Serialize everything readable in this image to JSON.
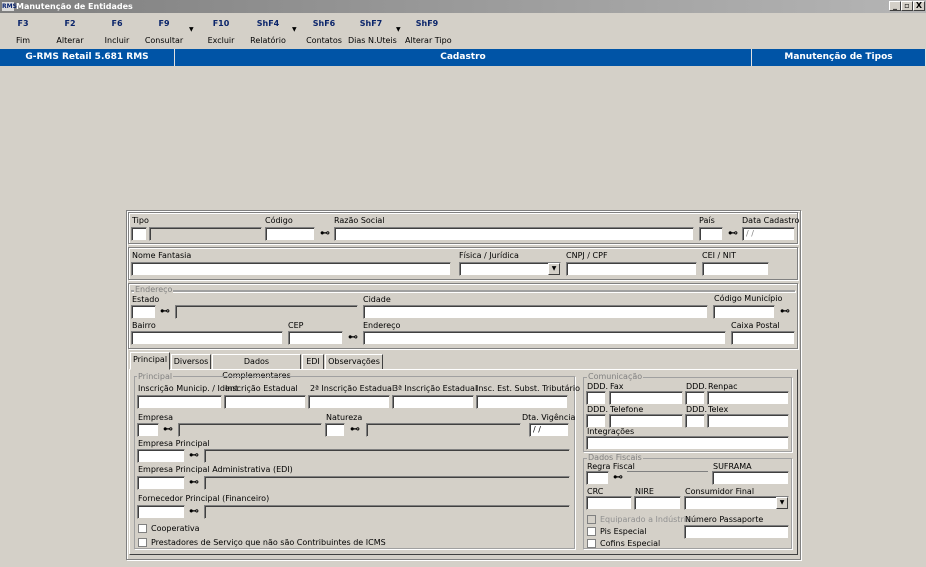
{
  "window": {
    "title": "Manutenção de Entidades",
    "app_icon_text": "RMS",
    "controls": [
      "_",
      "▫",
      "X"
    ]
  },
  "toolbar": [
    {
      "key": "F3",
      "label": "Fim",
      "menu": false
    },
    {
      "key": "F2",
      "label": "Alterar",
      "menu": false
    },
    {
      "key": "F6",
      "label": "Incluir",
      "menu": false
    },
    {
      "key": "F9",
      "label": "Consultar",
      "menu": true
    },
    {
      "key": "F10",
      "label": "Excluir",
      "menu": false
    },
    {
      "key": "ShF4",
      "label": "Relatório",
      "menu": true
    },
    {
      "key": "ShF6",
      "label": "Contatos",
      "menu": false
    },
    {
      "key": "ShF7",
      "label": "Dias N.Uteis",
      "menu": true
    },
    {
      "key": "ShF9",
      "label": "Alterar Tipo",
      "menu": false
    }
  ],
  "header": {
    "app_version": "G-RMS Retail 5.681 RMS",
    "section": "Cadastro",
    "screen": "Manutenção de Tipos"
  },
  "form": {
    "tipo": {
      "label": "Tipo",
      "value": ""
    },
    "codigo": {
      "label": "Código",
      "value": ""
    },
    "razao_social": {
      "label": "Razão Social",
      "value": ""
    },
    "pais": {
      "label": "País",
      "value": ""
    },
    "data_cadastro": {
      "label": "Data Cadastro",
      "value": " / /"
    },
    "nome_fantasia": {
      "label": "Nome Fantasia",
      "value": ""
    },
    "fisica_juridica": {
      "label": "Física / Jurídica",
      "value": ""
    },
    "cnpj_cpf": {
      "label": "CNPJ / CPF",
      "value": ""
    },
    "cei_nit": {
      "label": "CEI / NIT",
      "value": ""
    }
  },
  "endereco": {
    "group_title": "Endereço",
    "estado": "Estado",
    "cidade": "Cidade",
    "codigo_municipio": "Código Município",
    "bairro": "Bairro",
    "cep": "CEP",
    "endereco": "Endereço",
    "caixa_postal": "Caixa Postal"
  },
  "tabs": [
    "Principal",
    "Diversos",
    "Dados Complementares",
    "EDI",
    "Observações"
  ],
  "principal": {
    "group_title": "Principal",
    "insc_municipal": "Inscrição Municip. / Ident",
    "insc_estadual": "Inscrição Estadual",
    "insc_estadual_2": "2ª Inscrição Estadual",
    "insc_estadual_3": "3ª Inscrição Estadual",
    "insc_subst": "Insc. Est. Subst. Tributário",
    "empresa": "Empresa",
    "natureza": "Natureza",
    "dta_vigencia": "Dta. Vigência",
    "dta_vigencia_value": " / /",
    "empresa_principal": "Empresa Principal",
    "empresa_principal_adm": "Empresa Principal Administrativa (EDI)",
    "fornecedor_principal": "Fornecedor Principal (Financeiro)",
    "cooperativa": "Cooperativa",
    "prestadores": "Prestadores de Serviço que não são Contribuintes de ICMS"
  },
  "comunicacao": {
    "group_title": "Comunicação",
    "ddd": "DDD.",
    "fax": "Fax",
    "renpac": "Renpac",
    "telefone": "Telefone",
    "telex": "Telex",
    "integracoes": "Integrações"
  },
  "dados_fiscais": {
    "group_title": "Dados Fiscais",
    "regra_fiscal": "Regra Fiscal",
    "suframa": "SUFRAMA",
    "crc": "CRC",
    "nire": "NIRE",
    "consumidor_final": "Consumidor Final",
    "equiparado": "Equiparado a Indústria",
    "numero_passaporte": "Número Passaporte",
    "pis_especial": "Pis Especial",
    "cofins_especial": "Cofins Especial"
  },
  "icons": {
    "lookup": "binoculars-icon",
    "dropdown": "chevron-down-icon"
  },
  "colors": {
    "header_blue": "#0054a6",
    "function_key": "#0a246a",
    "background": "#d4d0c8"
  }
}
